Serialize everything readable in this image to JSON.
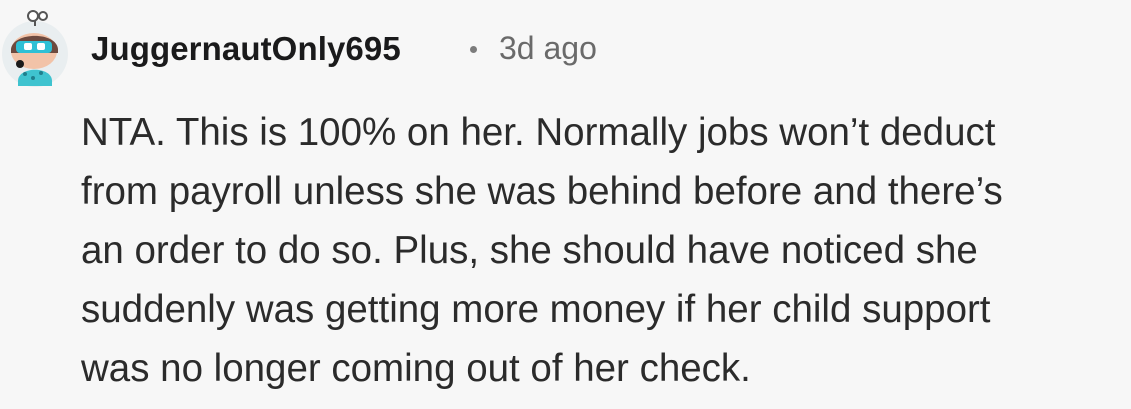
{
  "comment": {
    "author": "JuggernautOnly695",
    "separator": "•",
    "timestamp": "3d ago",
    "avatar_icon": "reddit-snoo-avatar-icon",
    "body_lines": [
      "NTA. This is 100% on her. Normally jobs won’t deduct",
      "from payroll unless she was behind before and there’s",
      "an order to do so. Plus, she should have noticed she",
      "suddenly was getting more money if her child support",
      "was no longer coming out of her check."
    ]
  },
  "colors": {
    "background": "#f7f7f7",
    "username": "#1a1a1b",
    "meta": "#6a6a6a",
    "body": "#2b2b2b",
    "avatar_accent": "#38c7d6"
  }
}
